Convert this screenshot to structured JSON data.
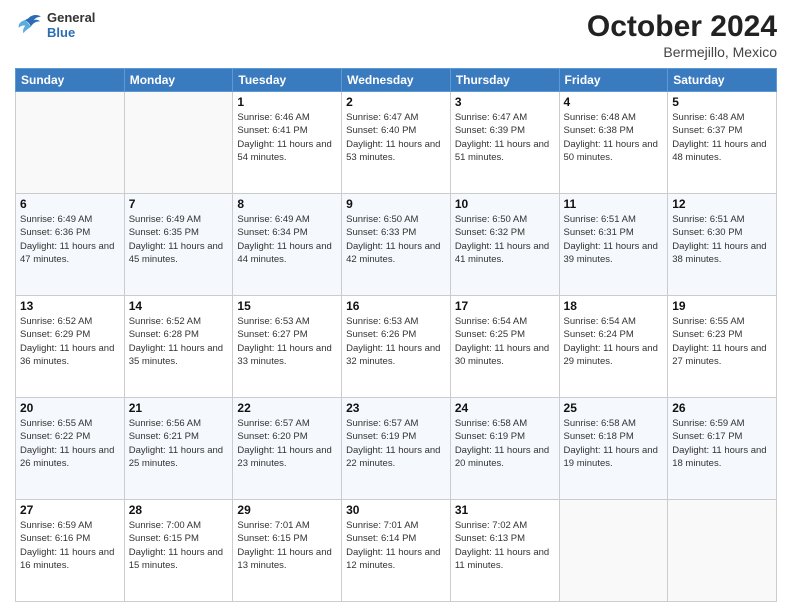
{
  "header": {
    "logo_general": "General",
    "logo_blue": "Blue",
    "title": "October 2024",
    "location": "Bermejillo, Mexico"
  },
  "days_of_week": [
    "Sunday",
    "Monday",
    "Tuesday",
    "Wednesday",
    "Thursday",
    "Friday",
    "Saturday"
  ],
  "weeks": [
    [
      {
        "day": "",
        "sunrise": "",
        "sunset": "",
        "daylight": ""
      },
      {
        "day": "",
        "sunrise": "",
        "sunset": "",
        "daylight": ""
      },
      {
        "day": "1",
        "sunrise": "Sunrise: 6:46 AM",
        "sunset": "Sunset: 6:41 PM",
        "daylight": "Daylight: 11 hours and 54 minutes."
      },
      {
        "day": "2",
        "sunrise": "Sunrise: 6:47 AM",
        "sunset": "Sunset: 6:40 PM",
        "daylight": "Daylight: 11 hours and 53 minutes."
      },
      {
        "day": "3",
        "sunrise": "Sunrise: 6:47 AM",
        "sunset": "Sunset: 6:39 PM",
        "daylight": "Daylight: 11 hours and 51 minutes."
      },
      {
        "day": "4",
        "sunrise": "Sunrise: 6:48 AM",
        "sunset": "Sunset: 6:38 PM",
        "daylight": "Daylight: 11 hours and 50 minutes."
      },
      {
        "day": "5",
        "sunrise": "Sunrise: 6:48 AM",
        "sunset": "Sunset: 6:37 PM",
        "daylight": "Daylight: 11 hours and 48 minutes."
      }
    ],
    [
      {
        "day": "6",
        "sunrise": "Sunrise: 6:49 AM",
        "sunset": "Sunset: 6:36 PM",
        "daylight": "Daylight: 11 hours and 47 minutes."
      },
      {
        "day": "7",
        "sunrise": "Sunrise: 6:49 AM",
        "sunset": "Sunset: 6:35 PM",
        "daylight": "Daylight: 11 hours and 45 minutes."
      },
      {
        "day": "8",
        "sunrise": "Sunrise: 6:49 AM",
        "sunset": "Sunset: 6:34 PM",
        "daylight": "Daylight: 11 hours and 44 minutes."
      },
      {
        "day": "9",
        "sunrise": "Sunrise: 6:50 AM",
        "sunset": "Sunset: 6:33 PM",
        "daylight": "Daylight: 11 hours and 42 minutes."
      },
      {
        "day": "10",
        "sunrise": "Sunrise: 6:50 AM",
        "sunset": "Sunset: 6:32 PM",
        "daylight": "Daylight: 11 hours and 41 minutes."
      },
      {
        "day": "11",
        "sunrise": "Sunrise: 6:51 AM",
        "sunset": "Sunset: 6:31 PM",
        "daylight": "Daylight: 11 hours and 39 minutes."
      },
      {
        "day": "12",
        "sunrise": "Sunrise: 6:51 AM",
        "sunset": "Sunset: 6:30 PM",
        "daylight": "Daylight: 11 hours and 38 minutes."
      }
    ],
    [
      {
        "day": "13",
        "sunrise": "Sunrise: 6:52 AM",
        "sunset": "Sunset: 6:29 PM",
        "daylight": "Daylight: 11 hours and 36 minutes."
      },
      {
        "day": "14",
        "sunrise": "Sunrise: 6:52 AM",
        "sunset": "Sunset: 6:28 PM",
        "daylight": "Daylight: 11 hours and 35 minutes."
      },
      {
        "day": "15",
        "sunrise": "Sunrise: 6:53 AM",
        "sunset": "Sunset: 6:27 PM",
        "daylight": "Daylight: 11 hours and 33 minutes."
      },
      {
        "day": "16",
        "sunrise": "Sunrise: 6:53 AM",
        "sunset": "Sunset: 6:26 PM",
        "daylight": "Daylight: 11 hours and 32 minutes."
      },
      {
        "day": "17",
        "sunrise": "Sunrise: 6:54 AM",
        "sunset": "Sunset: 6:25 PM",
        "daylight": "Daylight: 11 hours and 30 minutes."
      },
      {
        "day": "18",
        "sunrise": "Sunrise: 6:54 AM",
        "sunset": "Sunset: 6:24 PM",
        "daylight": "Daylight: 11 hours and 29 minutes."
      },
      {
        "day": "19",
        "sunrise": "Sunrise: 6:55 AM",
        "sunset": "Sunset: 6:23 PM",
        "daylight": "Daylight: 11 hours and 27 minutes."
      }
    ],
    [
      {
        "day": "20",
        "sunrise": "Sunrise: 6:55 AM",
        "sunset": "Sunset: 6:22 PM",
        "daylight": "Daylight: 11 hours and 26 minutes."
      },
      {
        "day": "21",
        "sunrise": "Sunrise: 6:56 AM",
        "sunset": "Sunset: 6:21 PM",
        "daylight": "Daylight: 11 hours and 25 minutes."
      },
      {
        "day": "22",
        "sunrise": "Sunrise: 6:57 AM",
        "sunset": "Sunset: 6:20 PM",
        "daylight": "Daylight: 11 hours and 23 minutes."
      },
      {
        "day": "23",
        "sunrise": "Sunrise: 6:57 AM",
        "sunset": "Sunset: 6:19 PM",
        "daylight": "Daylight: 11 hours and 22 minutes."
      },
      {
        "day": "24",
        "sunrise": "Sunrise: 6:58 AM",
        "sunset": "Sunset: 6:19 PM",
        "daylight": "Daylight: 11 hours and 20 minutes."
      },
      {
        "day": "25",
        "sunrise": "Sunrise: 6:58 AM",
        "sunset": "Sunset: 6:18 PM",
        "daylight": "Daylight: 11 hours and 19 minutes."
      },
      {
        "day": "26",
        "sunrise": "Sunrise: 6:59 AM",
        "sunset": "Sunset: 6:17 PM",
        "daylight": "Daylight: 11 hours and 18 minutes."
      }
    ],
    [
      {
        "day": "27",
        "sunrise": "Sunrise: 6:59 AM",
        "sunset": "Sunset: 6:16 PM",
        "daylight": "Daylight: 11 hours and 16 minutes."
      },
      {
        "day": "28",
        "sunrise": "Sunrise: 7:00 AM",
        "sunset": "Sunset: 6:15 PM",
        "daylight": "Daylight: 11 hours and 15 minutes."
      },
      {
        "day": "29",
        "sunrise": "Sunrise: 7:01 AM",
        "sunset": "Sunset: 6:15 PM",
        "daylight": "Daylight: 11 hours and 13 minutes."
      },
      {
        "day": "30",
        "sunrise": "Sunrise: 7:01 AM",
        "sunset": "Sunset: 6:14 PM",
        "daylight": "Daylight: 11 hours and 12 minutes."
      },
      {
        "day": "31",
        "sunrise": "Sunrise: 7:02 AM",
        "sunset": "Sunset: 6:13 PM",
        "daylight": "Daylight: 11 hours and 11 minutes."
      },
      {
        "day": "",
        "sunrise": "",
        "sunset": "",
        "daylight": ""
      },
      {
        "day": "",
        "sunrise": "",
        "sunset": "",
        "daylight": ""
      }
    ]
  ]
}
